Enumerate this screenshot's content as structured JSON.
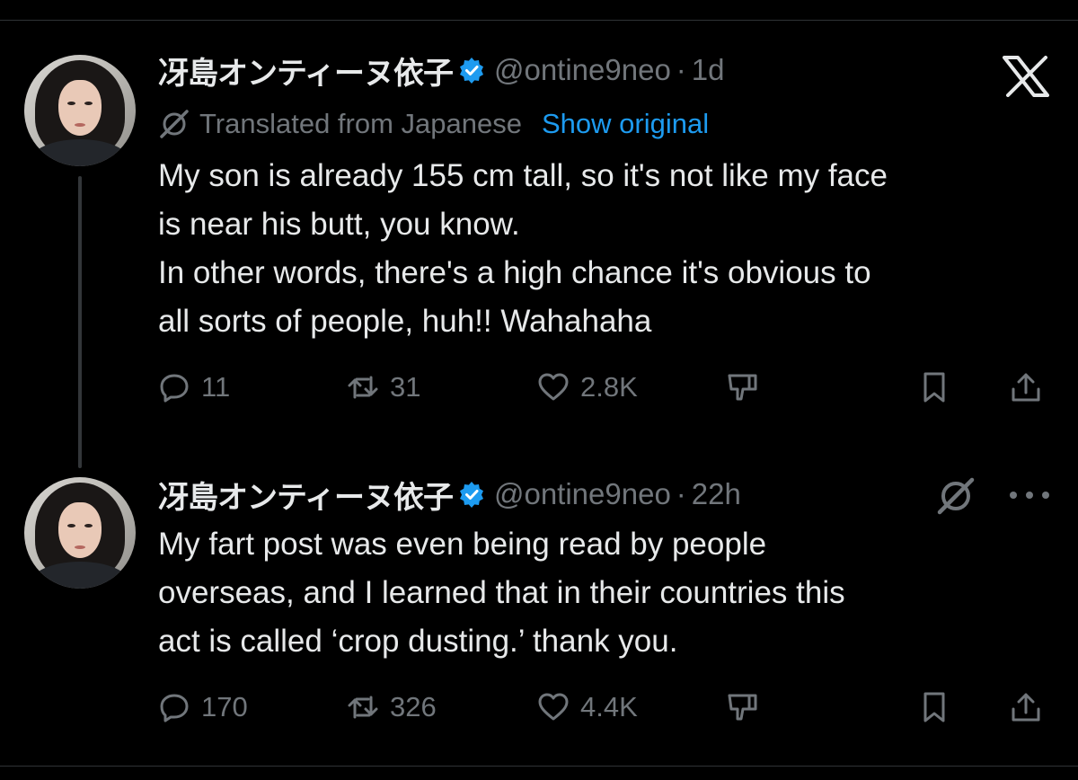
{
  "brand": {
    "logo_icon": "x-logo-icon"
  },
  "colors": {
    "background": "#000000",
    "text": "#e7e9ea",
    "muted": "#71767b",
    "link": "#1d9bf0",
    "verified": "#1d9bf0"
  },
  "tweets": [
    {
      "display_name": "冴島オンティーヌ依子",
      "handle": "@ontine9neo",
      "separator": "·",
      "time": "1d",
      "verified": true,
      "translation": {
        "label": "Translated from Japanese",
        "action": "Show original"
      },
      "lines": [
        "My son is already 155 cm tall, so it's not like my face",
        "is near his butt, you know.",
        "In other words, there's a high chance it's obvious to",
        "all sorts of people, huh!! Wahahaha"
      ],
      "replies": "11",
      "reposts": "31",
      "likes": "2.8K"
    },
    {
      "display_name": "冴島オンティーヌ依子",
      "handle": "@ontine9neo",
      "separator": "·",
      "time": "22h",
      "verified": true,
      "lines": [
        "My fart post was even being read by people",
        "overseas, and I learned that in their countries this",
        "act is called ‘crop dusting.’ thank you."
      ],
      "replies": "170",
      "reposts": "326",
      "likes": "4.4K"
    }
  ]
}
